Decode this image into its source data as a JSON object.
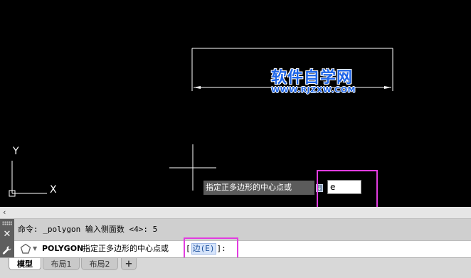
{
  "canvas": {
    "watermark": {
      "title": "软件自学网",
      "url": "WWW.RJZXW.COM"
    },
    "ucs": {
      "x_label": "X",
      "y_label": "Y"
    },
    "dynamic_input": {
      "prompt": "指定正多边形的中心点或",
      "arrow_glyph": "↓",
      "value": "e"
    }
  },
  "command_window": {
    "collapse_glyph": "‹",
    "close_glyph": "✕",
    "history": "命令: _polygon 输入侧面数 <4>: 5",
    "current": {
      "command": "POLYGON",
      "prompt": "指定正多边形的中心点或",
      "option_open": "[",
      "option_label": "边",
      "option_key": "(E)",
      "option_close": "]:"
    }
  },
  "tabs": {
    "model": "模型",
    "layout1": "布局1",
    "layout2": "布局2",
    "add": "+"
  },
  "colors": {
    "canvas_bg": "#000000",
    "highlight": "#e23ce0",
    "watermark": "#1f66e8"
  }
}
